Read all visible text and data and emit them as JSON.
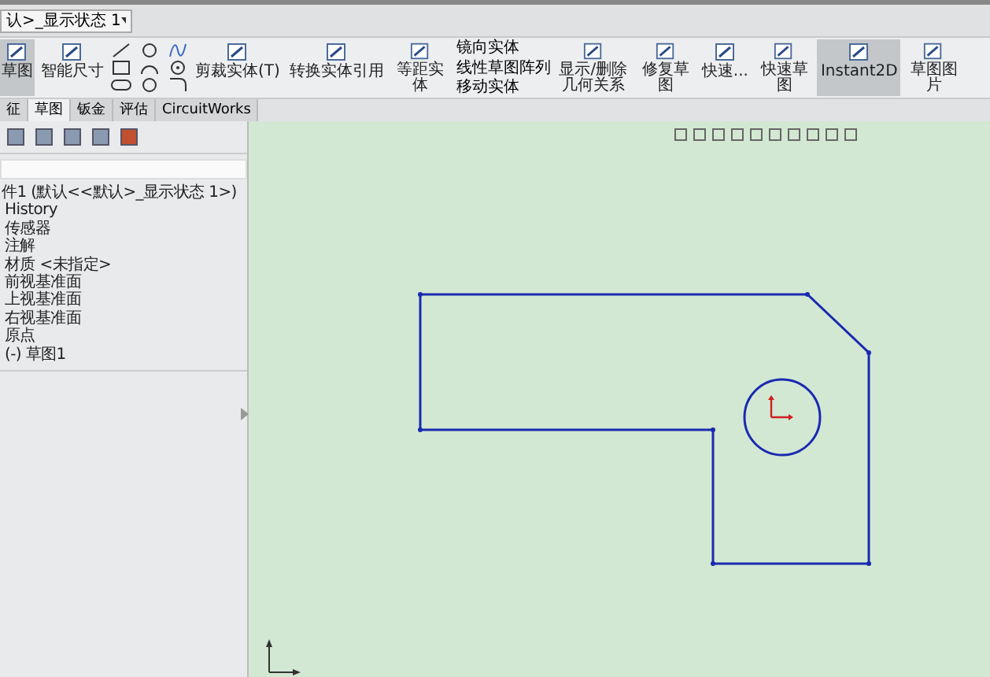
{
  "config_dropdown": {
    "value": "认>_显示状态 1"
  },
  "ribbon": [
    {
      "kind": "sketch",
      "label": "草图",
      "selected": true
    },
    {
      "kind": "large",
      "label": "智能尺寸",
      "selected": false
    },
    {
      "kind": "grid"
    },
    {
      "kind": "large",
      "label": "剪裁实体(T)",
      "selected": false
    },
    {
      "kind": "large",
      "label": "转换实体引用",
      "selected": false
    },
    {
      "kind": "large",
      "label": "等距实体",
      "selected": false
    },
    {
      "kind": "list",
      "items": [
        "镜向实体",
        "线性草图阵列",
        "移动实体"
      ]
    },
    {
      "kind": "large",
      "label": "显示/删除几何关系",
      "selected": false
    },
    {
      "kind": "large",
      "label": "修复草图",
      "selected": false
    },
    {
      "kind": "large",
      "label": "快速...",
      "selected": false
    },
    {
      "kind": "large",
      "label": "快速草图",
      "selected": false
    },
    {
      "kind": "large",
      "label": "Instant2D",
      "selected": true
    },
    {
      "kind": "large",
      "label": "草图图片",
      "selected": false
    }
  ],
  "tabs": [
    {
      "label": "征",
      "selected": false
    },
    {
      "label": "草图",
      "selected": true
    },
    {
      "label": "钣金",
      "selected": false
    },
    {
      "label": "评估",
      "selected": false
    },
    {
      "label": "CircuitWorks",
      "selected": false
    }
  ],
  "tree": {
    "root": "件1 (默认<<默认>_显示状态 1>)",
    "items": [
      "History",
      "传感器",
      "注解",
      "材质 <未指定>",
      "前视基准面",
      "上视基准面",
      "右视基准面",
      "原点",
      "(-) 草图1"
    ]
  }
}
